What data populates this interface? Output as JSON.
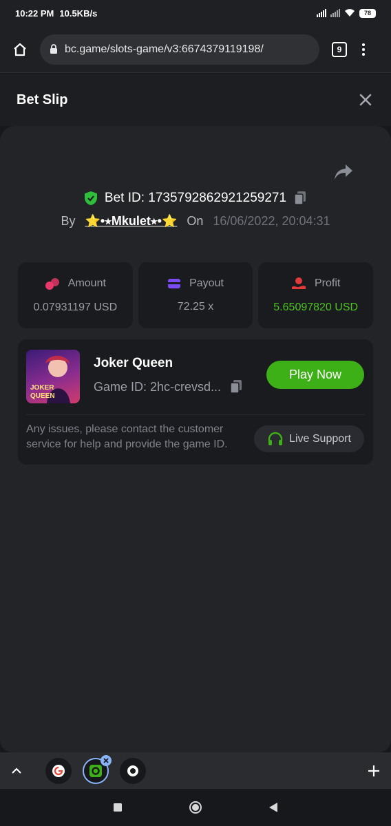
{
  "status_bar": {
    "time": "10:22 PM",
    "speed": "10.5KB/s",
    "battery": "78"
  },
  "browser": {
    "url": "bc.game/slots-game/v3:6674379119198/",
    "tab_count": "9"
  },
  "header": {
    "title": "Bet Slip"
  },
  "bet": {
    "bet_id_label": "Bet ID: 1735792862921259271",
    "by_label": "By",
    "user": "⭐•⭒Mkulet⭒•⭐",
    "on_label": "On",
    "date": "16/06/2022, 20:04:31"
  },
  "stats": [
    {
      "label": "Amount",
      "value": "0.07931197 USD",
      "icon": "amount-icon",
      "color": "#e8396a"
    },
    {
      "label": "Payout",
      "value": "72.25 x",
      "icon": "payout-icon",
      "color": "#7b4cf2"
    },
    {
      "label": "Profit",
      "value": "5.65097820 USD",
      "icon": "profit-icon",
      "color": "#e23a3a"
    }
  ],
  "game": {
    "name": "Joker Queen",
    "game_id": "Game ID: 2hc-crevsd...",
    "thumb_text_1": "JOKER",
    "thumb_text_2": "QUEEN",
    "play_label": "Play Now",
    "issue_text": "Any issues, please contact the customer service for help and provide the game ID.",
    "support_label": "Live Support"
  },
  "colors": {
    "accent_green": "#3cb016",
    "profit_green": "#4cc41e",
    "panel_bg": "#232428",
    "card_bg": "#1a1b1e"
  }
}
